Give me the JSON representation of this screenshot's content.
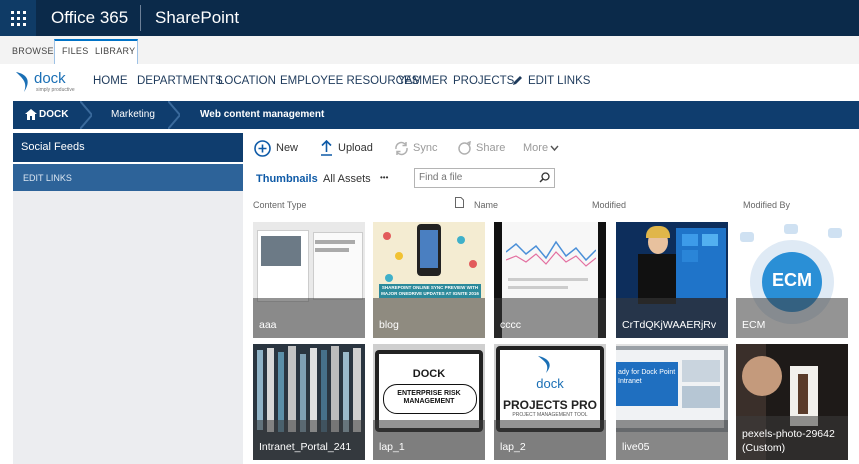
{
  "suite": {
    "brand": "Office 365",
    "app": "SharePoint"
  },
  "ribbon": {
    "tabs": [
      "BROWSE",
      "FILES",
      "LIBRARY"
    ]
  },
  "logo": {
    "name": "dock",
    "tagline": "simply productive"
  },
  "topnav": {
    "items": [
      "HOME",
      "DEPARTMENTS",
      "LOCATION",
      "EMPLOYEE RESOURCES",
      "YAMMER",
      "PROJECTS"
    ],
    "edit_links": "EDIT LINKS"
  },
  "breadcrumb": {
    "items": [
      "DOCK",
      "Marketing",
      "Web content management"
    ]
  },
  "leftnav": {
    "heading": "Social Feeds",
    "edit_links": "EDIT LINKS"
  },
  "commands": {
    "new": "New",
    "upload": "Upload",
    "sync": "Sync",
    "share": "Share",
    "more": "More"
  },
  "views": {
    "thumbnails": "Thumbnails",
    "all_assets": "All Assets",
    "ellipsis": "•••"
  },
  "search": {
    "placeholder": "Find a file"
  },
  "columns": {
    "content_type": "Content Type",
    "name": "Name",
    "modified": "Modified",
    "modified_by": "Modified By"
  },
  "tiles": [
    {
      "name": "aaa"
    },
    {
      "name": "blog"
    },
    {
      "name": "cccc"
    },
    {
      "name": "CrTdQKjWAAERjRv"
    },
    {
      "name": "ECM"
    },
    {
      "name": "Intranet_Portal_241"
    },
    {
      "name": "lap_1"
    },
    {
      "name": "lap_2"
    },
    {
      "name": "live05"
    },
    {
      "name": "pexels-photo-29642",
      "name_line2": "(Custom)"
    }
  ],
  "tile_text": {
    "blog_banner": "SHAREPOINT ONLINE SYNC PREVIEW WITH MAJOR ONEDRIVE UPDATES AT IGNITE 2016",
    "ecm": "ECM",
    "lap1_brand": "DOCK",
    "lap1_title": "ENTERPRISE RISK MANAGEMENT",
    "lap2_brand": "dock",
    "lap2_title": "PROJECTS PRO",
    "lap2_sub": "PROJECT MANAGEMENT TOOL",
    "live05_text": "ady for Dock Point Intranet"
  },
  "colors": {
    "suite_bg": "#0b2a4a",
    "nav_dark": "#0f3d6e",
    "accent": "#0072c6",
    "left_sel": "#2d6399"
  }
}
